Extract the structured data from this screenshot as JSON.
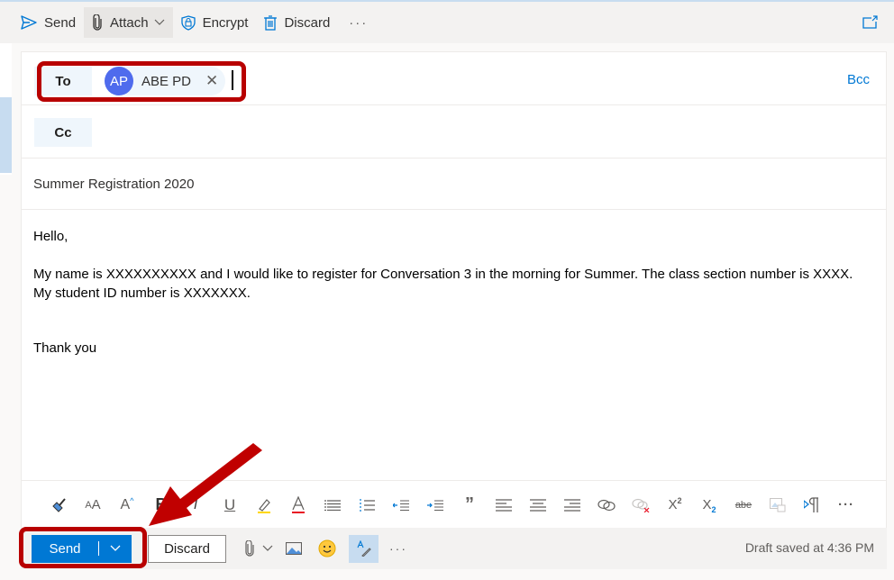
{
  "toolbar": {
    "send": "Send",
    "attach": "Attach",
    "encrypt": "Encrypt",
    "discard": "Discard",
    "more": "···",
    "icons": [
      "send-icon",
      "paperclip-icon",
      "shield-lock-icon",
      "trash-icon",
      "popout-icon"
    ]
  },
  "compose": {
    "to_label": "To",
    "recipient": {
      "initials": "AP",
      "name": "ABE PD",
      "remove": "✕",
      "avatar_color": "#4f6bed"
    },
    "bcc_label": "Bcc",
    "cc_label": "Cc",
    "subject": "Summer Registration 2020",
    "body": {
      "greeting": "Hello,",
      "line1": "My name is XXXXXXXXXX and I would like to register for Conversation 3 in the morning for Summer. The class section number is XXXX.",
      "line2": "My student ID number is XXXXXXX.",
      "closing": "Thank you"
    }
  },
  "format_toolbar": {
    "items": [
      "format-painter",
      "font-size",
      "grow-font",
      "bold",
      "italic",
      "underline",
      "highlight",
      "font-color",
      "bullets",
      "numbering",
      "decrease-indent",
      "increase-indent",
      "quote",
      "align-left",
      "align-center",
      "align-right",
      "insert-link",
      "remove-link",
      "superscript",
      "subscript",
      "strikethrough",
      "insert-table-image",
      "ltr-paragraph",
      "more"
    ],
    "bold_label": "B",
    "quote_label": "”",
    "more_label": "···"
  },
  "bottom_bar": {
    "send": "Send",
    "discard": "Discard",
    "more": "···",
    "draft_status": "Draft saved at 4:36 PM"
  },
  "annotations": {
    "highlight_color": "#b80000",
    "targets": [
      "to-field",
      "send-button"
    ]
  },
  "colors": {
    "accent": "#0078d4",
    "toolbar_bg": "#f3f2f1",
    "field_label_bg": "#eff6fc"
  }
}
